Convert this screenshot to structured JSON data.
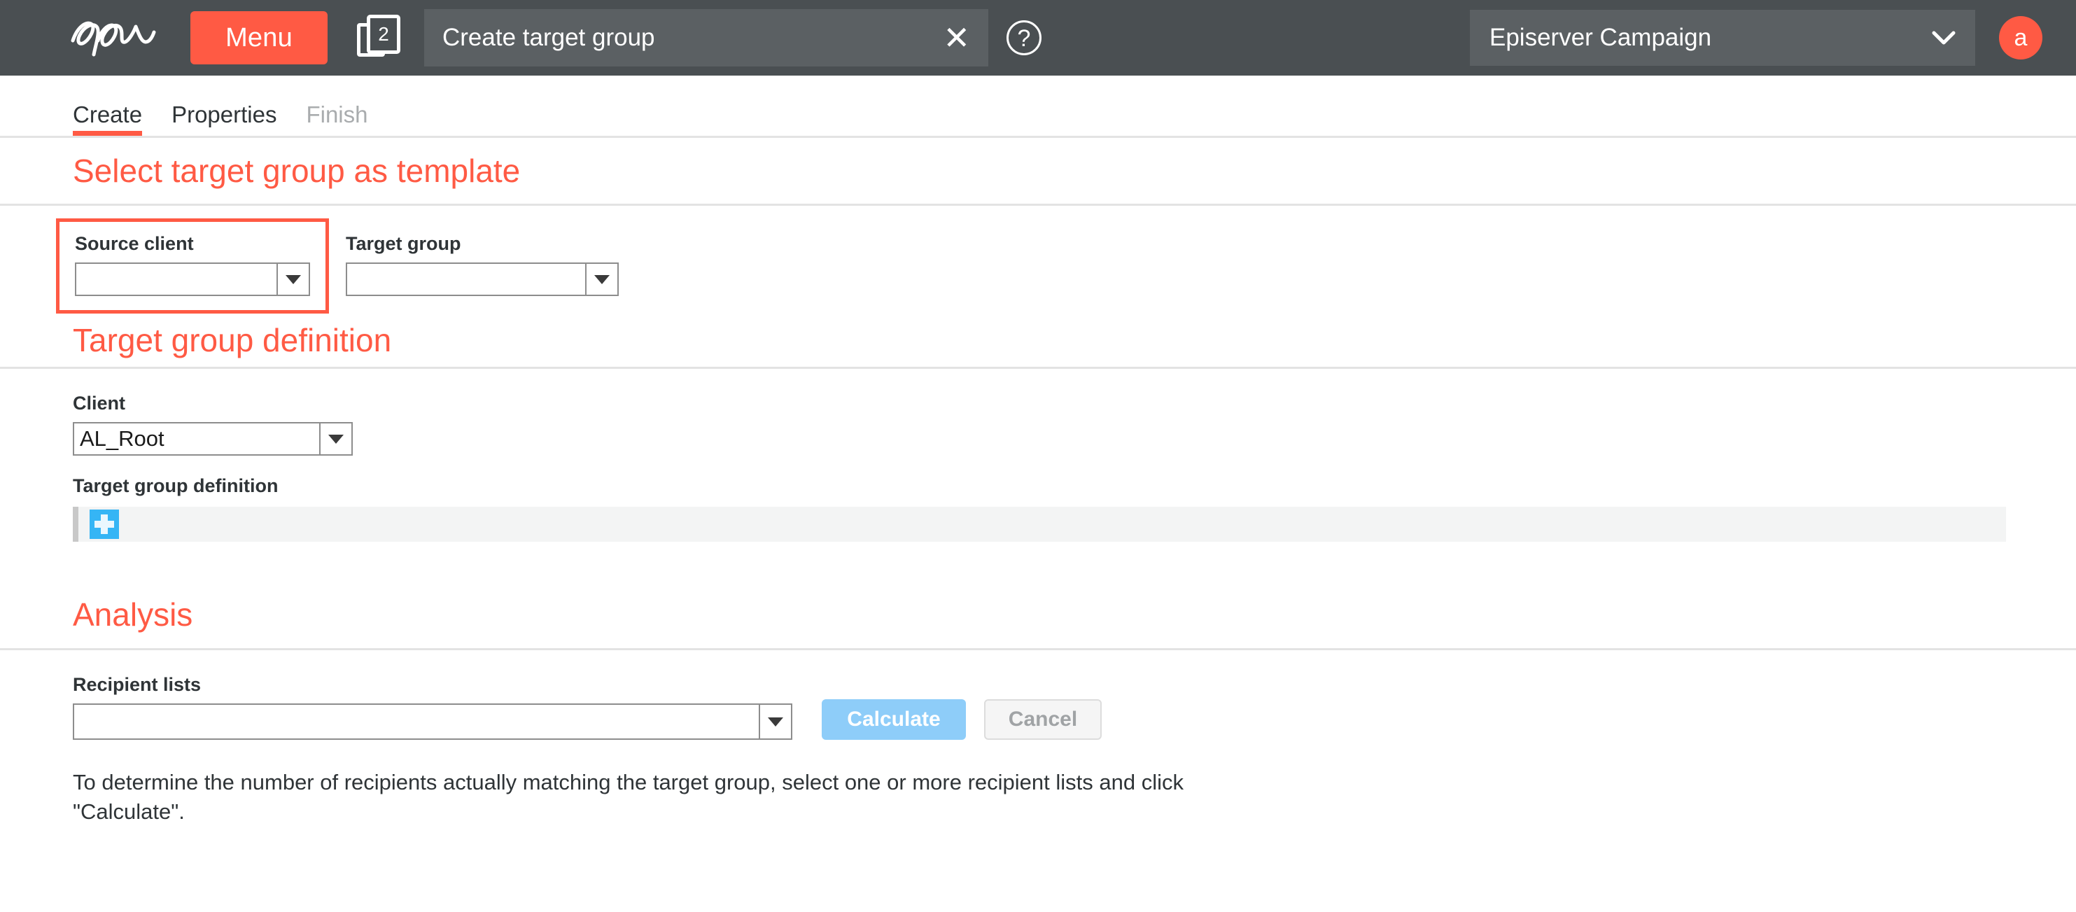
{
  "topbar": {
    "logo_alt": "episerver-logo",
    "menu_label": "Menu",
    "doc_count": "2",
    "window_title": "Create target group",
    "close_label": "✕",
    "help_label": "?",
    "product_name": "Episerver Campaign",
    "product_chevron": "⌄",
    "avatar_initial": "a"
  },
  "tabs": [
    {
      "label": "Create",
      "state": "active"
    },
    {
      "label": "Properties",
      "state": "enabled"
    },
    {
      "label": "Finish",
      "state": "disabled"
    }
  ],
  "template_section": {
    "heading": "Select target group as template",
    "source_client": {
      "label": "Source client",
      "value": "",
      "placeholder": ""
    },
    "target_group": {
      "label": "Target group",
      "value": "",
      "placeholder": ""
    }
  },
  "definition_section": {
    "heading": "Target group definition",
    "client": {
      "label": "Client",
      "value": "AL_Root"
    },
    "definition": {
      "label": "Target group definition",
      "add_icon": "plus-icon"
    }
  },
  "analysis_section": {
    "heading": "Analysis",
    "recipient_lists": {
      "label": "Recipient lists",
      "value": "",
      "placeholder": ""
    },
    "calculate_label": "Calculate",
    "cancel_label": "Cancel",
    "hint": "To determine the number of recipients actually matching the target group, select one or more recipient lists and click \"Calculate\"."
  },
  "colors": {
    "brand_orange": "#ff5a44",
    "topbar_bg": "#4a4f52",
    "field_bg": "#5b6063",
    "accent_blue": "#8ecdf9",
    "plus_blue": "#35b5f5",
    "divider": "#e3e3e3"
  }
}
